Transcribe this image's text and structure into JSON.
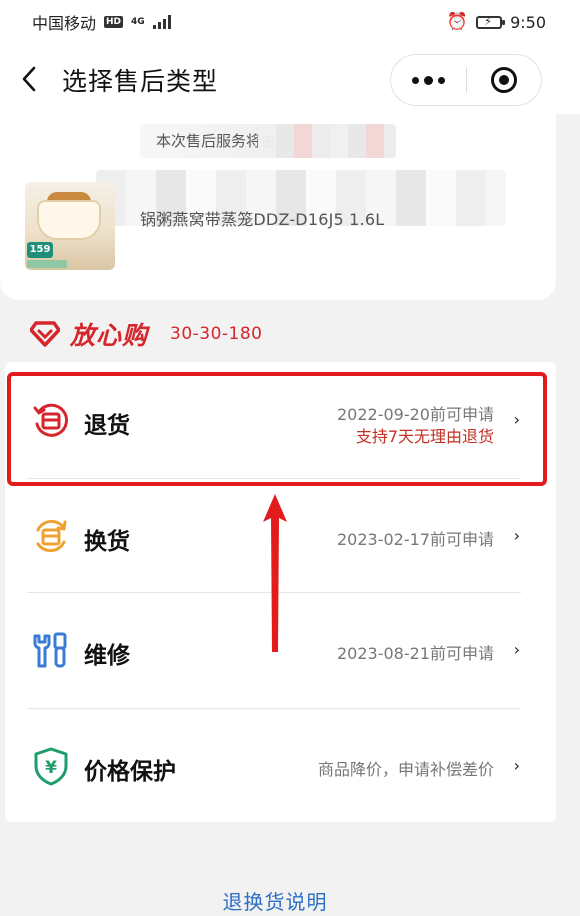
{
  "status_bar": {
    "carrier": "中国移动",
    "hd_tag": "HD",
    "network": "4G",
    "time": "9:50"
  },
  "header": {
    "title": "选择售后类型"
  },
  "product": {
    "notice": "本次售后服务将由",
    "name": "锅粥燕窝带蒸笼DDZ-D16J5 1.6L",
    "thumb_price": "159"
  },
  "assurance": {
    "title": "放心购",
    "subtitle": "30-30-180"
  },
  "options": [
    {
      "icon": "return-box-icon",
      "label": "退货",
      "deadline": "2022-09-20前可申请",
      "note": "支持7天无理由退货",
      "color": "#d6262b"
    },
    {
      "icon": "exchange-box-icon",
      "label": "换货",
      "deadline": "2023-02-17前可申请",
      "note": "",
      "color": "#f0a030"
    },
    {
      "icon": "repair-wrench-icon",
      "label": "维修",
      "deadline": "2023-08-21前可申请",
      "note": "",
      "color": "#3a7bd5"
    },
    {
      "icon": "price-protect-shield-icon",
      "label": "价格保护",
      "deadline": "商品降价，申请补偿差价",
      "note": "",
      "color": "#1f9d6b"
    }
  ],
  "chevron": "›",
  "footer": {
    "link": "退换货说明"
  }
}
